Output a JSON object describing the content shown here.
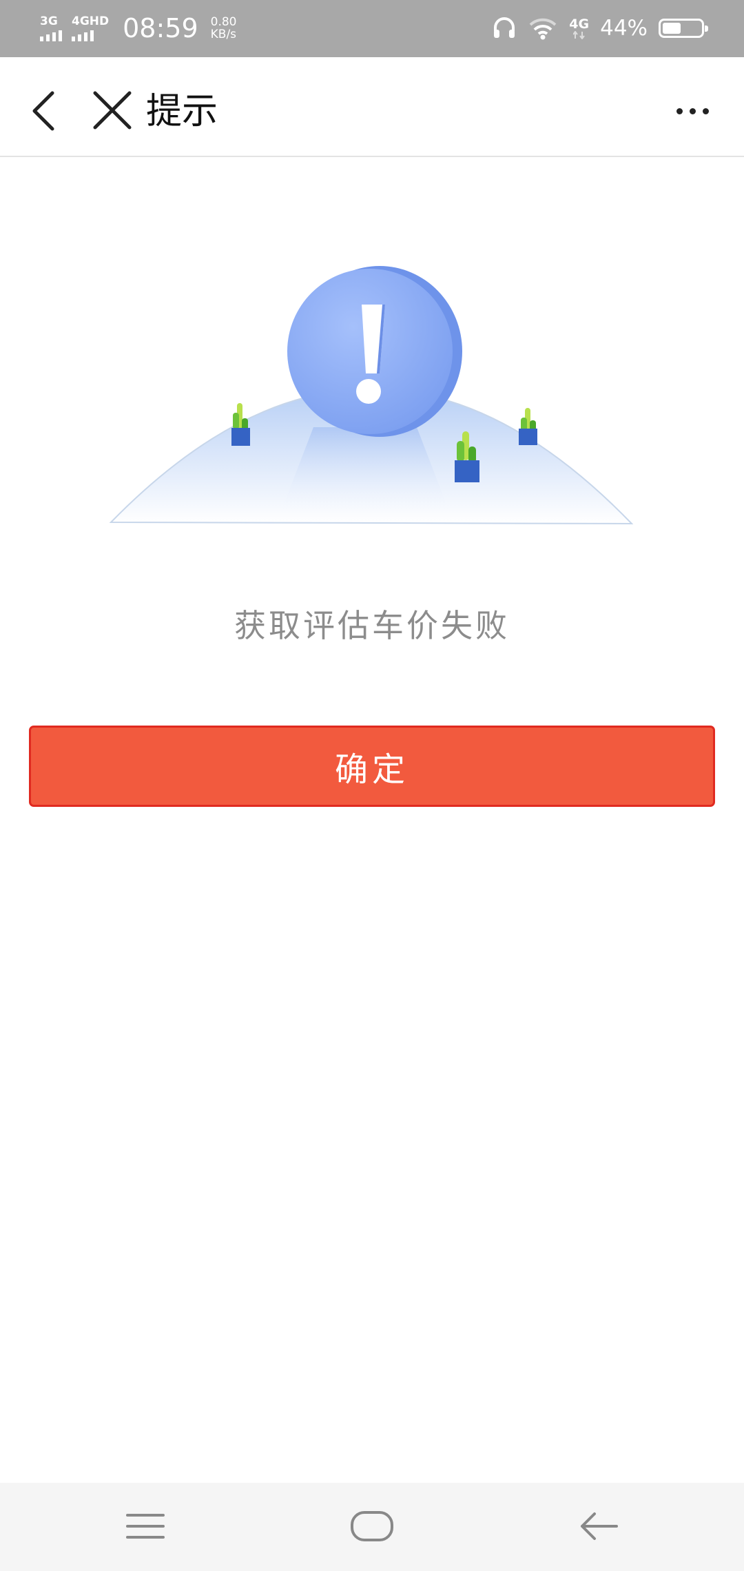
{
  "status_bar": {
    "sim1": "3G",
    "sim2": "4GHD",
    "time": "08:59",
    "speed_value": "0.80",
    "speed_unit": "KB/s",
    "lte": "4G",
    "battery": "44%"
  },
  "header": {
    "title": "提示"
  },
  "main": {
    "message": "获取评估车价失败",
    "confirm_label": "确定"
  },
  "colors": {
    "accent": "#f25a3e",
    "status_bar": "#a8a8a8"
  }
}
